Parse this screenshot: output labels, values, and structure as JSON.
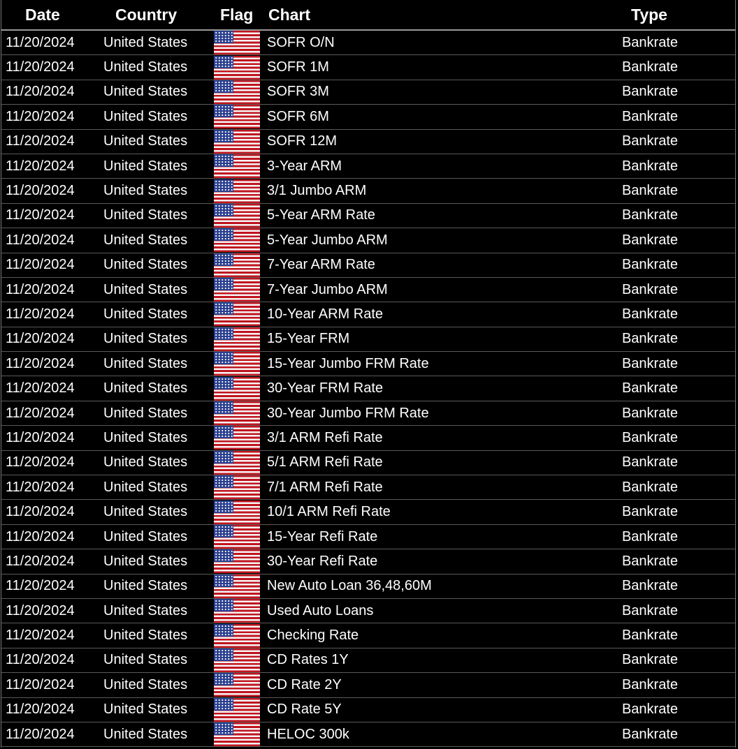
{
  "columns": {
    "date": "Date",
    "country": "Country",
    "flag": "Flag",
    "chart": "Chart",
    "type": "Type"
  },
  "rows": [
    {
      "date": "11/20/2024",
      "country": "United States",
      "chart": "SOFR O/N",
      "type": "Bankrate"
    },
    {
      "date": "11/20/2024",
      "country": "United States",
      "chart": "SOFR 1M",
      "type": "Bankrate"
    },
    {
      "date": "11/20/2024",
      "country": "United States",
      "chart": "SOFR 3M",
      "type": "Bankrate"
    },
    {
      "date": "11/20/2024",
      "country": "United States",
      "chart": "SOFR 6M",
      "type": "Bankrate"
    },
    {
      "date": "11/20/2024",
      "country": "United States",
      "chart": "SOFR 12M",
      "type": "Bankrate"
    },
    {
      "date": "11/20/2024",
      "country": "United States",
      "chart": "3-Year ARM",
      "type": "Bankrate"
    },
    {
      "date": "11/20/2024",
      "country": "United States",
      "chart": "3/1 Jumbo ARM",
      "type": "Bankrate"
    },
    {
      "date": "11/20/2024",
      "country": "United States",
      "chart": "5-Year ARM Rate",
      "type": "Bankrate"
    },
    {
      "date": "11/20/2024",
      "country": "United States",
      "chart": "5-Year Jumbo ARM",
      "type": "Bankrate"
    },
    {
      "date": "11/20/2024",
      "country": "United States",
      "chart": "7-Year ARM Rate",
      "type": "Bankrate"
    },
    {
      "date": "11/20/2024",
      "country": "United States",
      "chart": "7-Year Jumbo ARM",
      "type": "Bankrate"
    },
    {
      "date": "11/20/2024",
      "country": "United States",
      "chart": "10-Year ARM Rate",
      "type": "Bankrate"
    },
    {
      "date": "11/20/2024",
      "country": "United States",
      "chart": "15-Year FRM",
      "type": "Bankrate"
    },
    {
      "date": "11/20/2024",
      "country": "United States",
      "chart": "15-Year Jumbo FRM Rate",
      "type": "Bankrate"
    },
    {
      "date": "11/20/2024",
      "country": "United States",
      "chart": "30-Year FRM Rate",
      "type": "Bankrate"
    },
    {
      "date": "11/20/2024",
      "country": "United States",
      "chart": "30-Year Jumbo FRM Rate",
      "type": "Bankrate"
    },
    {
      "date": "11/20/2024",
      "country": "United States",
      "chart": "3/1 ARM Refi Rate",
      "type": "Bankrate"
    },
    {
      "date": "11/20/2024",
      "country": "United States",
      "chart": "5/1 ARM Refi Rate",
      "type": "Bankrate"
    },
    {
      "date": "11/20/2024",
      "country": "United States",
      "chart": "7/1 ARM Refi Rate",
      "type": "Bankrate"
    },
    {
      "date": "11/20/2024",
      "country": "United States",
      "chart": "10/1 ARM Refi Rate",
      "type": "Bankrate"
    },
    {
      "date": "11/20/2024",
      "country": "United States",
      "chart": "15-Year Refi Rate",
      "type": "Bankrate"
    },
    {
      "date": "11/20/2024",
      "country": "United States",
      "chart": "30-Year Refi Rate",
      "type": "Bankrate"
    },
    {
      "date": "11/20/2024",
      "country": "United States",
      "chart": "New Auto Loan 36,48,60M",
      "type": "Bankrate"
    },
    {
      "date": "11/20/2024",
      "country": "United States",
      "chart": "Used Auto Loans",
      "type": "Bankrate"
    },
    {
      "date": "11/20/2024",
      "country": "United States",
      "chart": "Checking Rate",
      "type": "Bankrate"
    },
    {
      "date": "11/20/2024",
      "country": "United States",
      "chart": "CD Rates 1Y",
      "type": "Bankrate"
    },
    {
      "date": "11/20/2024",
      "country": "United States",
      "chart": "CD Rate 2Y",
      "type": "Bankrate"
    },
    {
      "date": "11/20/2024",
      "country": "United States",
      "chart": "CD Rate 5Y",
      "type": "Bankrate"
    },
    {
      "date": "11/20/2024",
      "country": "United States",
      "chart": "HELOC 300k",
      "type": "Bankrate"
    }
  ],
  "flag_icon": "us-flag-icon",
  "colors": {
    "background": "#000000",
    "text": "#ffffff",
    "flag_red": "#c0141f",
    "flag_blue": "#2a3f8f"
  }
}
